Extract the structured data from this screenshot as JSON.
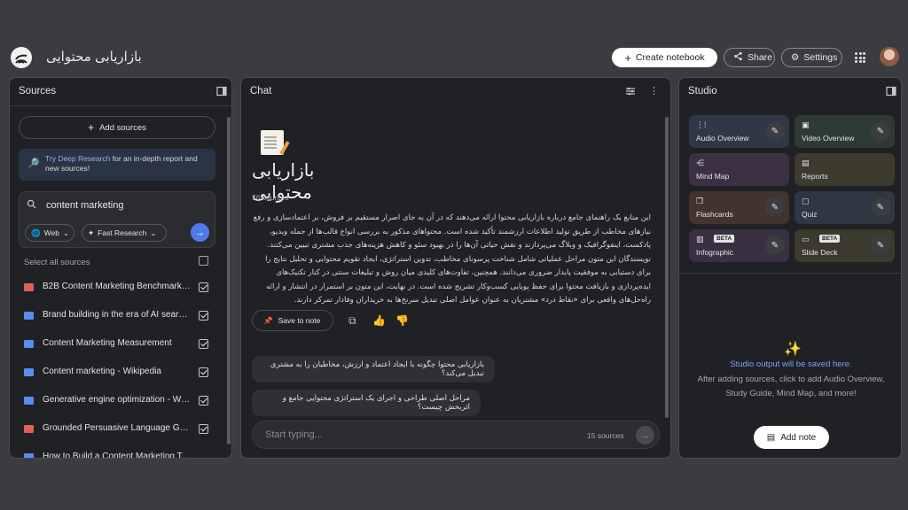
{
  "header": {
    "title": "بازاریابی محتوایی",
    "create_label": "Create notebook",
    "share_label": "Share",
    "settings_label": "Settings"
  },
  "sources": {
    "title": "Sources",
    "add_label": "Add sources",
    "deep_link": "Try Deep Research",
    "deep_text": " for an in-depth report and new sources!",
    "search_value": "content marketing",
    "web_label": "Web",
    "fast_label": "Fast Research",
    "select_all": "Select all sources",
    "items": [
      {
        "label": "B2B Content Marketing Benchmarks, ...",
        "type": "pdf"
      },
      {
        "label": "Brand building in the era of AI search:...",
        "type": "web"
      },
      {
        "label": "Content Marketing Measurement",
        "type": "web"
      },
      {
        "label": "Content marketing - Wikipedia",
        "type": "web"
      },
      {
        "label": "Generative engine optimization - Wiki...",
        "type": "web"
      },
      {
        "label": "Grounded Persuasive Language Gene...",
        "type": "pdf"
      },
      {
        "label": "How to Build a Content Marketing Tea...",
        "type": "web"
      }
    ]
  },
  "chat": {
    "title": "Chat",
    "notebook_title": "بازاریابی محتوایی",
    "source_count": "16 sources",
    "body": "این منابع یک راهنمای جامع درباره بازاریابی محتوا ارائه می‌دهند که در آن به جای اصرار مستقیم بر فروش، بر اعتمادسازی و رفع نیازهای مخاطب از طریق تولید اطلاعات ارزشمند تأکید شده است. محتواهای مذکور به بررسی انواع قالب‌ها از جمله ویدیو، پادکست، اینفوگرافیک و وبلاگ می‌پردازند و نقش حیاتی آن‌ها را در بهبود سئو و کاهش هزینه‌های جذب مشتری تبیین می‌کنند. نویسندگان این متون مراحل عملیاتی شامل شناخت پرسونای مخاطب، تدوین استراتژی، ایجاد تقویم محتوایی و تحلیل نتایج را برای دستیابی به موفقیت پایدار ضروری می‌دانند. همچنین، تفاوت‌های کلیدی میان روش و تبلیغات سنتی در کنار تکنیک‌های ایده‌پردازی و بازیافت محتوا برای حفظ پویایی کسب‌وکار تشریح شده است. در نهایت، این متون بر استمرار در انتشار و ارائه راه‌حل‌های واقعی برای «نقاط درد» مشتریان به عنوان عوامل اصلی تبدیل سرنخ‌ها به خریداران وفادار تمرکز دارند.",
    "save_label": "Save to note",
    "questions": [
      "بازاریابی محتوا چگونه با ایجاد اعتماد و ارزش، مخاطبان را به مشتری تبدیل می‌کند؟",
      "مراحل اصلی طراحی و اجرای یک استراتژی محتوایی جامع و اثربخش چیست؟"
    ],
    "placeholder": "Start typing...",
    "input_count": "15 sources"
  },
  "studio": {
    "title": "Studio",
    "tiles": [
      {
        "label": "Audio Overview",
        "color": "#303746"
      },
      {
        "label": "Video Overview",
        "color": "#2e3b34"
      },
      {
        "label": "Mind Map",
        "color": "#3b3044"
      },
      {
        "label": "Reports",
        "color": "#3d3b2e"
      },
      {
        "label": "Flashcards",
        "color": "#42332f"
      },
      {
        "label": "Quiz",
        "color": "#2e3742"
      },
      {
        "label": "Infographic",
        "color": "#3a3044",
        "badge": "BETA"
      },
      {
        "label": "Slide Deck",
        "color": "#3b3a2d",
        "badge": "BETA"
      }
    ],
    "output_title": "Studio output will be saved here.",
    "output_desc": "After adding sources, click to add Audio Overview, Study Guide, Mind Map, and more!",
    "add_note": "Add note"
  }
}
